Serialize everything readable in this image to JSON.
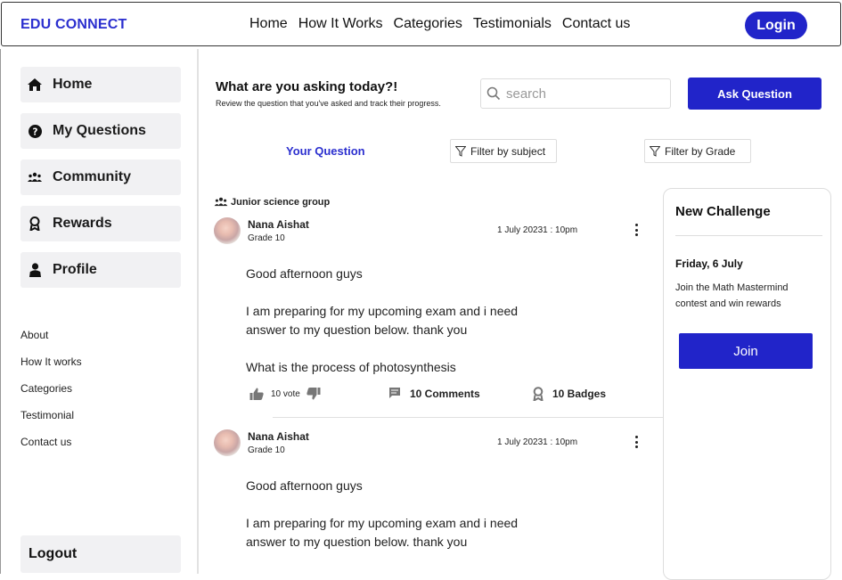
{
  "nav": {
    "brand": "EDU CONNECT",
    "links": [
      "Home",
      "How It Works",
      "Categories",
      "Testimonials",
      "Contact us"
    ],
    "login": "Login"
  },
  "sidebar": {
    "items": [
      {
        "label": "Home",
        "icon": "home-icon"
      },
      {
        "label": "My Questions",
        "icon": "question-circle-icon"
      },
      {
        "label": "Community",
        "icon": "users-icon"
      },
      {
        "label": "Rewards",
        "icon": "award-icon"
      },
      {
        "label": "Profile",
        "icon": "user-icon"
      }
    ],
    "links": [
      "About",
      "How It works",
      "Categories",
      "Testimonial",
      "Contact us"
    ],
    "logout": "Logout"
  },
  "main": {
    "title": "What are you asking today?!",
    "subtitle": "Review the question that you've asked and track their progress.",
    "search_placeholder": "search",
    "ask_button": "Ask Question",
    "your_question": "Your Question",
    "filter_subject": "Filter by subject",
    "filter_grade": "Filter by Grade",
    "group": "Junior science group",
    "posts": [
      {
        "name": "Nana Aishat",
        "grade": "Grade 10",
        "date": "1 July 20231 : 10pm",
        "lines": [
          "Good afternoon guys",
          "I am preparing for my upcoming exam and i need",
          "answer to my question below. thank you",
          "What is the process of photosynthesis"
        ],
        "votes": "10 vote",
        "comments": "10 Comments",
        "badges": "10 Badges"
      },
      {
        "name": "Nana Aishat",
        "grade": "Grade 10",
        "date": "1 July 20231 : 10pm",
        "lines": [
          "Good afternoon guys",
          "I am preparing for my upcoming exam and i need",
          "answer to my question below. thank you"
        ]
      }
    ]
  },
  "challenge": {
    "title": "New Challenge",
    "date": "Friday, 6 July",
    "description": "Join the Math Mastermind contest and win rewards",
    "join": "Join"
  },
  "colors": {
    "accent": "#2124c9",
    "brand": "#2b2fcf"
  }
}
